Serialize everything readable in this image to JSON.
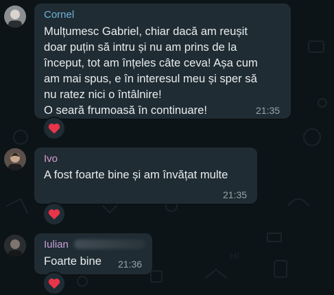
{
  "messages": [
    {
      "sender": "Cornel",
      "sender_color": "#6fb4d6",
      "avatar_icon": "person-photo",
      "lines": [
        "Mulțumesc Gabriel, chiar dacă am reușit",
        "doar puțin să intru și nu am prins de la",
        "început, tot am înțeles câte ceva! Așa cum",
        "am mai spus, e în interesul meu și sper să",
        "nu ratez nici o întâlnire!",
        "O seară frumoasă în continuare!"
      ],
      "time": "21:35",
      "reaction": "red-heart-icon"
    },
    {
      "sender": "Ivo",
      "sender_color": "#d99bd0",
      "avatar_icon": "person-photo",
      "lines": [
        "A fost foarte bine și am învățat multe"
      ],
      "time": "21:35",
      "reaction": "red-heart-icon"
    },
    {
      "sender": "Iulian",
      "sender_color": "#c8a0d8",
      "avatar_icon": "person-photo",
      "lines": [
        "Foarte bine"
      ],
      "time": "21:36",
      "reaction": "red-heart-icon"
    }
  ],
  "colors": {
    "background": "#0d1418",
    "bubble": "#1f2c33",
    "text": "#e9edef",
    "time": "#9aa3a8",
    "heart": "#e8354a"
  }
}
